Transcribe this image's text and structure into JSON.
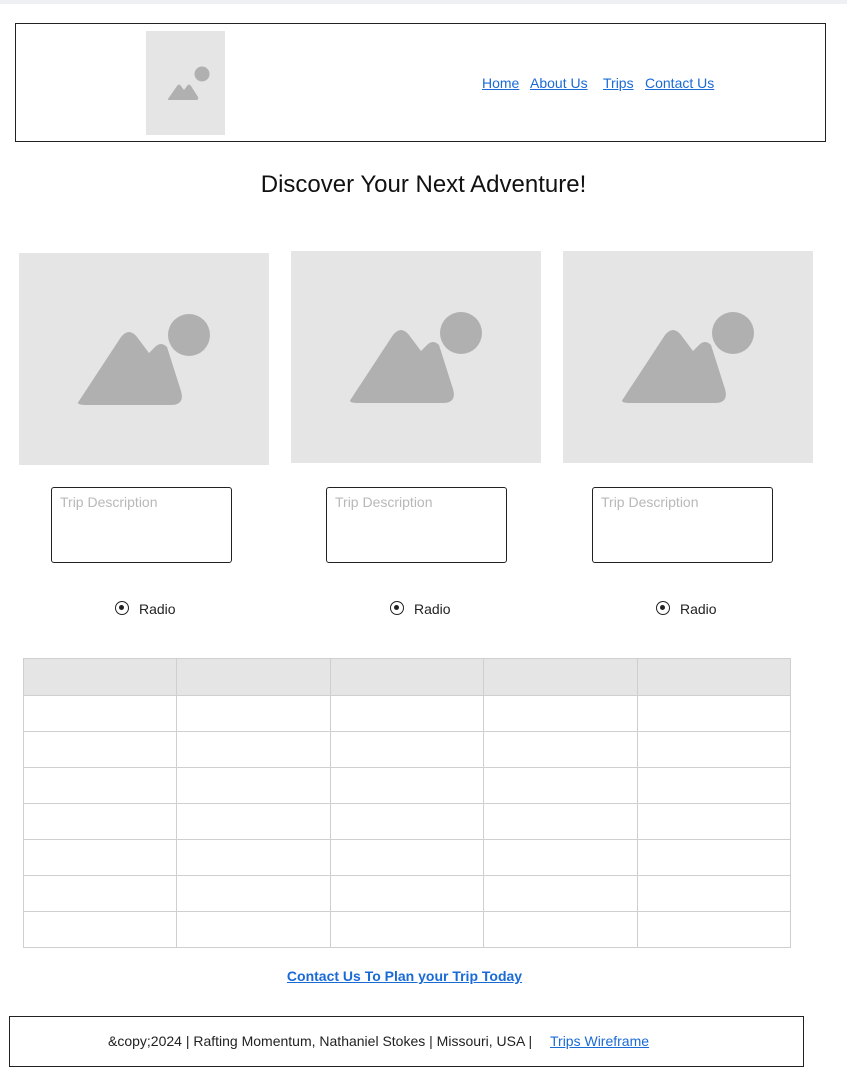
{
  "header": {
    "logo_icon": "image-placeholder-icon",
    "nav": [
      {
        "label": "Home"
      },
      {
        "label": "About Us"
      },
      {
        "label": "Trips"
      },
      {
        "label": "Contact Us"
      }
    ]
  },
  "main": {
    "title": "Discover Your Next Adventure!",
    "cards": [
      {
        "image_icon": "image-placeholder-icon",
        "description_placeholder": "Trip Description",
        "radio_label": "Radio",
        "radio_selected": true
      },
      {
        "image_icon": "image-placeholder-icon",
        "description_placeholder": "Trip Description",
        "radio_label": "Radio",
        "radio_selected": true
      },
      {
        "image_icon": "image-placeholder-icon",
        "description_placeholder": "Trip Description",
        "radio_label": "Radio",
        "radio_selected": true
      }
    ],
    "table": {
      "columns": 5,
      "body_rows": 7,
      "header_cells": [
        "",
        "",
        "",
        "",
        ""
      ]
    },
    "cta_label": "Contact Us To Plan your Trip Today"
  },
  "footer": {
    "copyright_text": "&copy;2024 | Rafting Momentum, Nathaniel Stokes | Missouri, USA |",
    "link_label": "Trips Wireframe"
  },
  "colors": {
    "link": "#1a6ad6",
    "placeholder_bg": "#e5e5e5",
    "placeholder_fg": "#b0b0b0",
    "table_header_bg": "#e5e5e5",
    "border": "#222222"
  }
}
